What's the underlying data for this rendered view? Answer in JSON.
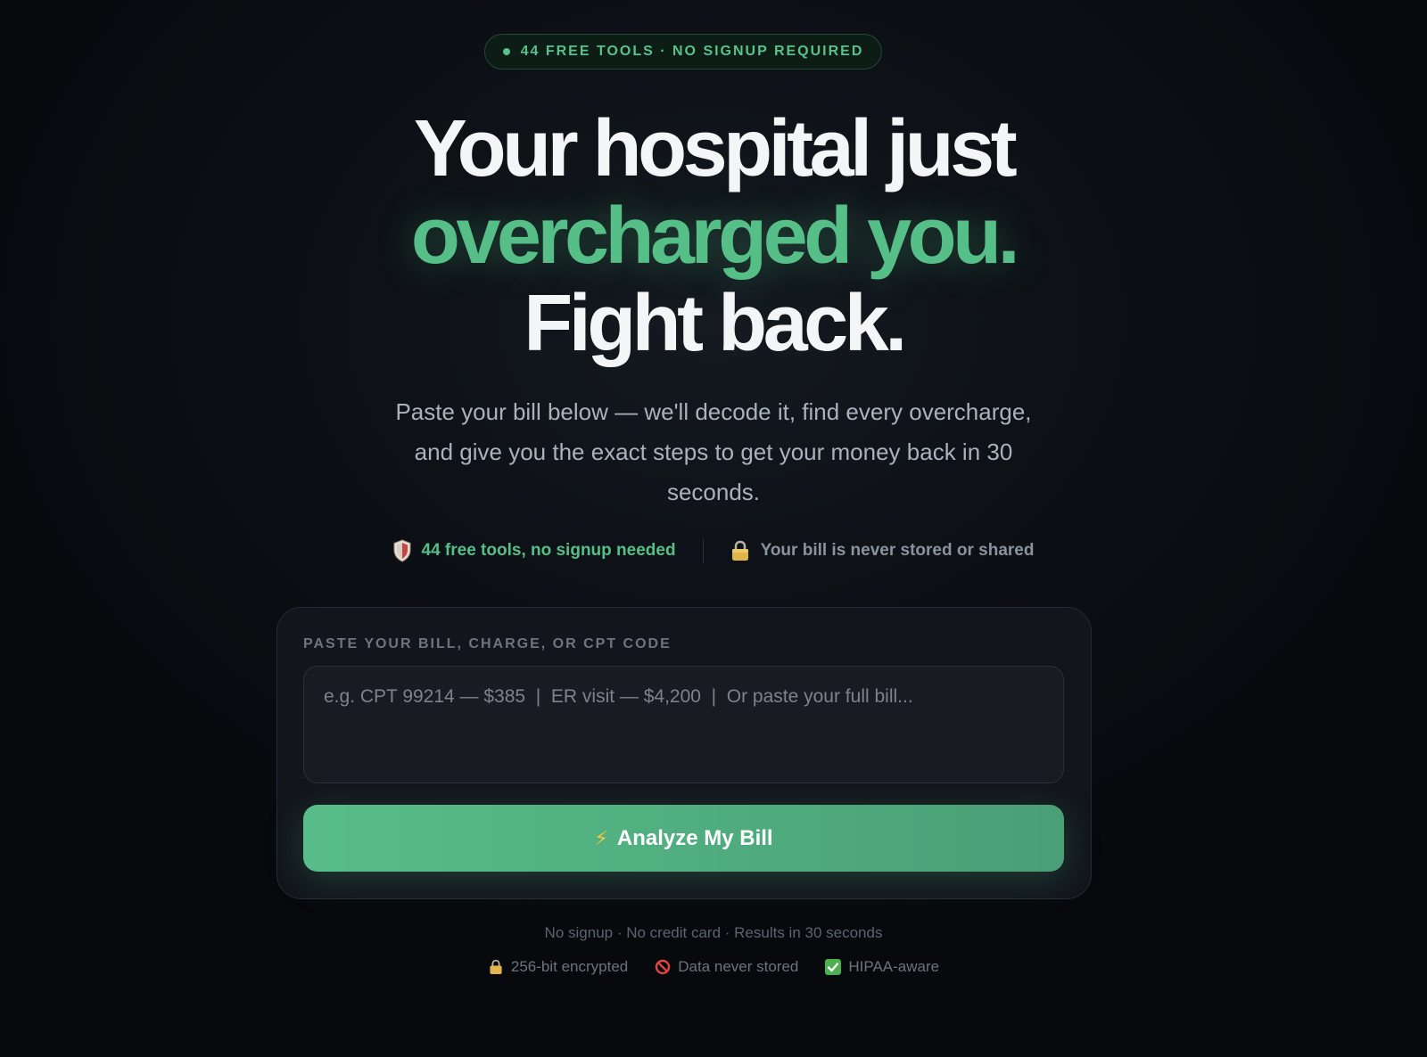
{
  "top_pill": {
    "text": "44 FREE TOOLS · NO SIGNUP REQUIRED"
  },
  "headline": {
    "line1": "Your hospital just",
    "line2": "overcharged you.",
    "line3": "Fight back."
  },
  "subheadline": "Paste your bill below — we'll decode it, find every overcharge, and give you the exact steps to get your money back in 30 seconds.",
  "trust_row": [
    {
      "icon": "shield-icon",
      "text": "44 free tools, no signup needed",
      "color": "#55bf87"
    },
    {
      "icon": "lock-icon",
      "text": "Your bill is never stored or shared",
      "color": "#8a929d"
    }
  ],
  "form": {
    "label": "PASTE YOUR BILL, CHARGE, OR CPT CODE",
    "value": "",
    "placeholder": "e.g. CPT 99214 — $385  |  ER visit — $4,200  |  Or paste your full bill...",
    "button_label": "Analyze My Bill",
    "button_icon": "lightning-icon"
  },
  "fine_print": "No signup · No credit card · Results in 30 seconds",
  "badges": [
    {
      "icon": "lock-icon",
      "text": "256-bit encrypted"
    },
    {
      "icon": "no-entry-icon",
      "text": "Data never stored"
    },
    {
      "icon": "check-icon",
      "text": "HIPAA-aware"
    }
  ],
  "colors": {
    "accent": "#55bf87",
    "background": "#0c0f14",
    "card": "#12151b"
  }
}
